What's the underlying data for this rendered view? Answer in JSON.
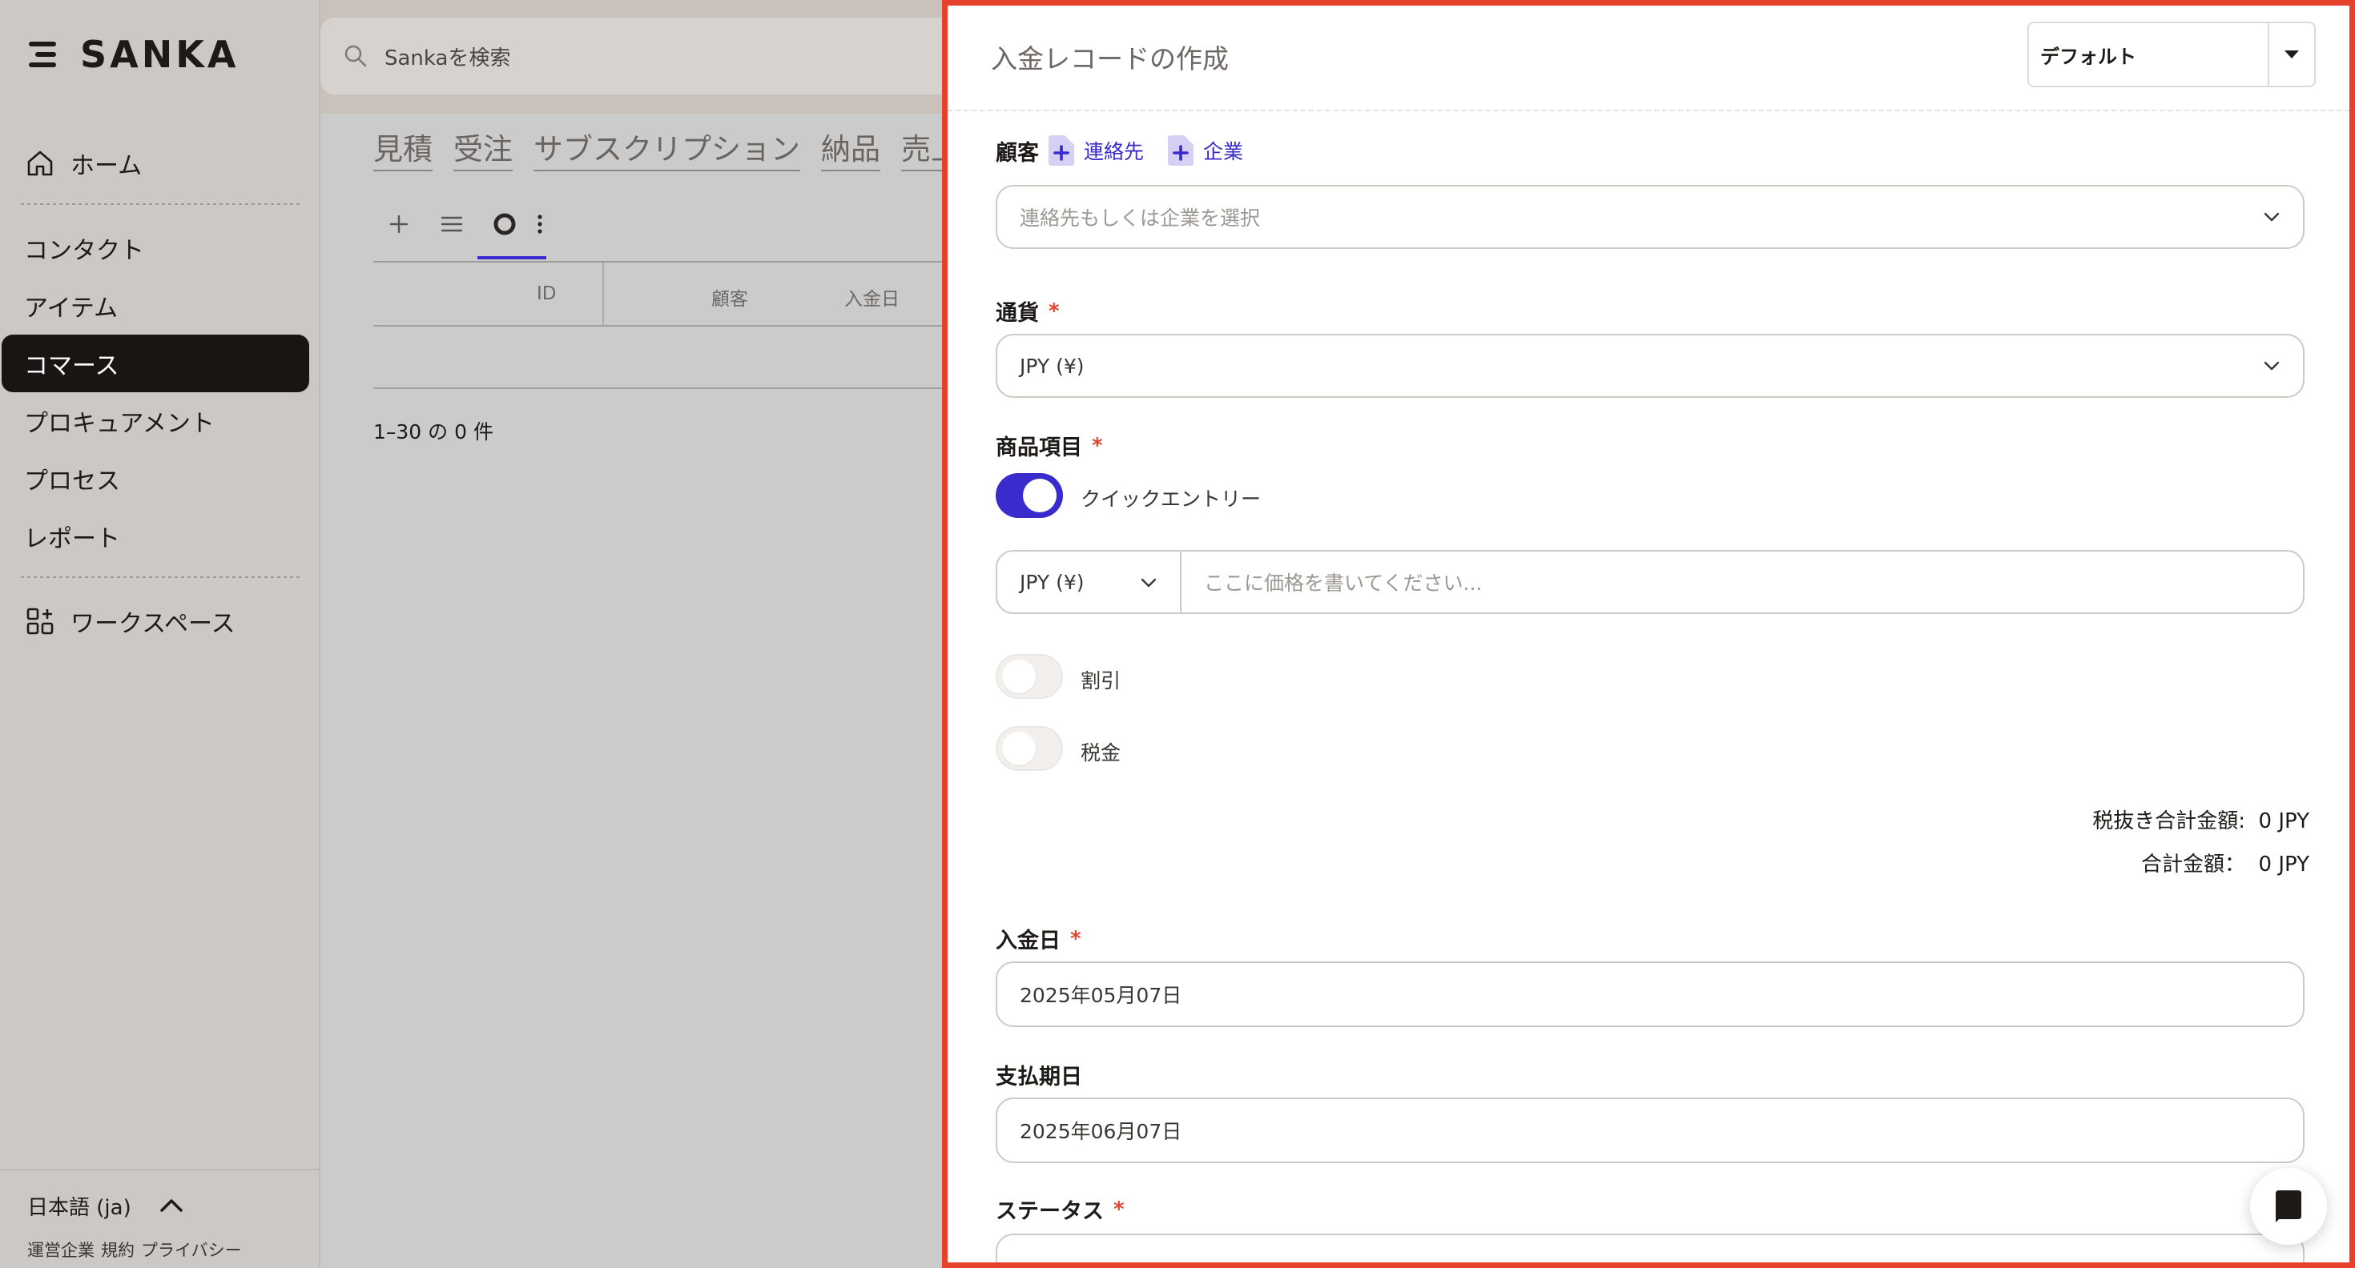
{
  "app": {
    "logo_text": "SANKA"
  },
  "search": {
    "placeholder": "Sankaを検索"
  },
  "sidebar": {
    "home": "ホーム",
    "items": [
      "コンタクト",
      "アイテム",
      "コマース",
      "プロキュアメント",
      "プロセス",
      "レポート"
    ],
    "active_item": "コマース",
    "workspace": "ワークスペース",
    "language": "日本語 (ja)",
    "footer_links": [
      "運営企業",
      "規約",
      "プライバシー"
    ]
  },
  "main": {
    "tabs": [
      "見積",
      "受注",
      "サブスクリプション",
      "納品",
      "売上"
    ],
    "table_headers": [
      "ID",
      "顧客",
      "入金日"
    ],
    "pagination": "1–30 の 0 件"
  },
  "drawer": {
    "title": "入金レコードの作成",
    "view_select": "デフォルト",
    "customer": {
      "label": "顧客",
      "add_contact": "連絡先",
      "add_company": "企業",
      "placeholder": "連絡先もしくは企業を選択"
    },
    "currency": {
      "label": "通貨",
      "value": "JPY (¥)"
    },
    "line_items": {
      "label": "商品項目",
      "quick_entry_label": "クイックエントリー",
      "quick_entry_on": true,
      "currency_value": "JPY (¥)",
      "price_placeholder": "ここに価格を書いてください..."
    },
    "discount": {
      "label": "割引",
      "on": false
    },
    "tax": {
      "label": "税金",
      "on": false
    },
    "totals": {
      "subtotal_label": "税抜き合計金額:",
      "subtotal_value": "0 JPY",
      "total_label": "合計金額：",
      "total_value": "0 JPY"
    },
    "payment_date": {
      "label": "入金日",
      "value": "2025年05月07日"
    },
    "due_date": {
      "label": "支払期日",
      "value": "2025年06月07日"
    },
    "status": {
      "label": "ステータス"
    }
  },
  "colors": {
    "accent": "#3a2ccc",
    "highlight_border": "#e5412d",
    "required": "#e0452f",
    "sidebar_active": "#1a1412"
  }
}
